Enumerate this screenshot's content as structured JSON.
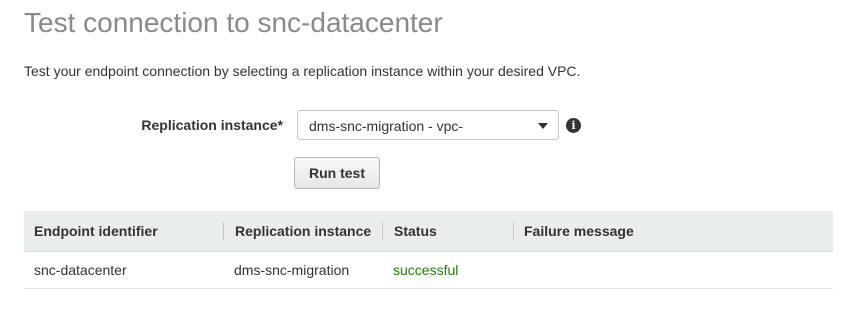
{
  "page": {
    "title": "Test connection to snc-datacenter",
    "description": "Test your endpoint connection by selecting a replication instance within your desired VPC."
  },
  "form": {
    "replication_label": "Replication instance*",
    "replication_value": "dms-snc-migration - vpc-",
    "info_icon": "info-icon",
    "run_test_label": "Run test"
  },
  "table": {
    "headers": [
      "Endpoint identifier",
      "Replication instance",
      "Status",
      "Failure message"
    ],
    "rows": [
      [
        "snc-datacenter",
        "dms-snc-migration",
        "successful",
        ""
      ]
    ]
  },
  "colors": {
    "success": "#1d8102",
    "title": "#8a8a8a",
    "header_bg": "#eaeded"
  }
}
